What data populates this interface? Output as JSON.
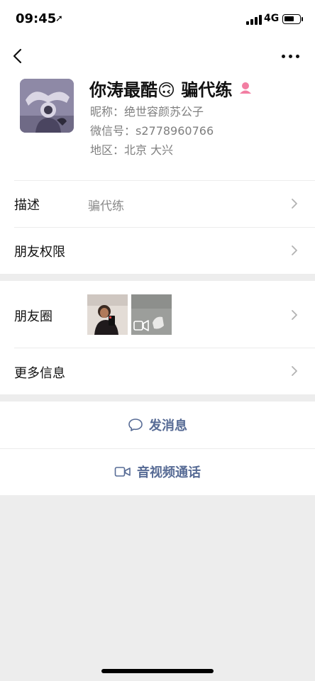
{
  "status_bar": {
    "time": "09:45",
    "network": "4G",
    "battery_level": 0.65
  },
  "nav": {
    "back_icon": "chevron-left-icon",
    "more_icon": "more-dots-icon"
  },
  "profile": {
    "name": "你涛最酷🙃 骗代练",
    "nickname": "昵称：绝世容颜苏公子",
    "wechat_id": "微信号：s2778960766",
    "region": "地区：北京 大兴",
    "gender_icon": "female-icon"
  },
  "rows": {
    "description": {
      "label": "描述",
      "value": "骗代练"
    },
    "permissions": {
      "label": "朋友权限"
    },
    "moments": {
      "label": "朋友圈"
    },
    "more_info": {
      "label": "更多信息"
    }
  },
  "actions": {
    "send_message": "发消息",
    "av_call": "音视频通话"
  },
  "colors": {
    "accent_link": "#576b95",
    "background": "#ededed",
    "gender_female": "#f27ea2"
  }
}
